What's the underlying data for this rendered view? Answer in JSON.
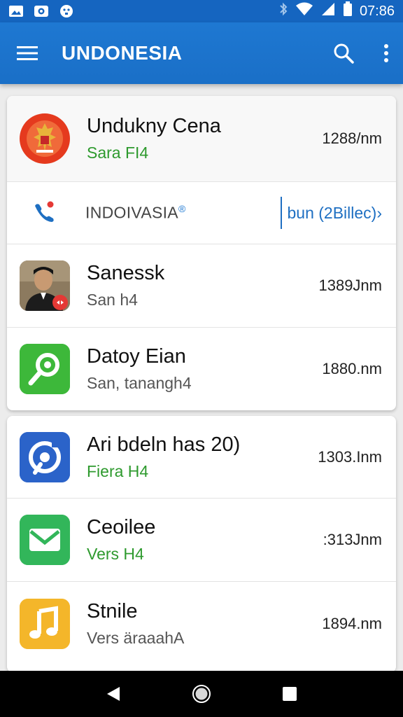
{
  "status_bar": {
    "time": "07:86",
    "left_icons": [
      "image-icon",
      "camera-icon",
      "face-icon"
    ],
    "right_icons": [
      "bluetooth-icon",
      "wifi-icon",
      "signal-icon",
      "battery-icon"
    ]
  },
  "app_bar": {
    "title": "UNDONESIA",
    "menu_icon": "menu-icon",
    "search_icon": "search-icon",
    "more_icon": "more-vert-icon"
  },
  "card1": {
    "items": [
      {
        "title": "Undukny Cena",
        "subtitle": "Sara FI4",
        "meta": "1288/nm",
        "icon": "emblem-icon",
        "color": "#e53a1e"
      },
      {
        "phone_label": "INDOIVASIA",
        "phone_sup": "®",
        "phone_link": "bun (2Billec)›",
        "icon": "phone-icon"
      },
      {
        "title": "Sanessk",
        "subtitle": "San h4",
        "meta": "1389Jnm",
        "icon": "person-photo",
        "color": "#5a4a3a"
      },
      {
        "title": "Datoy Eian",
        "subtitle": "San, tanangh4",
        "meta": "1880.nm",
        "icon": "search-icon",
        "color": "#3db83a"
      }
    ]
  },
  "card2": {
    "items": [
      {
        "title": "Ari bdeln has 20)",
        "subtitle": "Fiera H4",
        "meta": "1303.Inm",
        "icon": "music-disc-icon",
        "color": "#2b63c9"
      },
      {
        "title": "Ceoilee",
        "subtitle": "Vers H4",
        "meta": ":313Jnm",
        "icon": "mail-icon",
        "color": "#32b65a"
      },
      {
        "title": "Stnile",
        "subtitle": "Vers äraaahA",
        "meta": "1894.nm",
        "icon": "music-note-icon",
        "color": "#f4b62a"
      }
    ]
  },
  "nav_bar": {
    "back_icon": "back-icon",
    "home_icon": "home-icon",
    "recents_icon": "recents-icon"
  }
}
